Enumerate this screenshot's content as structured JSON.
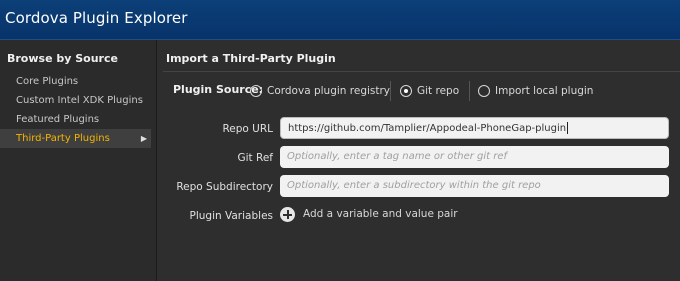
{
  "window": {
    "title": "Cordova Plugin Explorer"
  },
  "sidebar": {
    "heading": "Browse by Source",
    "items": [
      {
        "label": "Core Plugins"
      },
      {
        "label": "Custom Intel XDK Plugins"
      },
      {
        "label": "Featured Plugins"
      },
      {
        "label": "Third-Party Plugins",
        "active": true
      }
    ]
  },
  "main": {
    "heading": "Import a Third-Party Plugin",
    "plugin_source": {
      "label": "Plugin Source:",
      "options": [
        {
          "label": "Cordova plugin registry",
          "checked": false
        },
        {
          "label": "Git repo",
          "checked": true
        },
        {
          "label": "Import local plugin",
          "checked": false
        }
      ]
    },
    "repo_url": {
      "label": "Repo URL",
      "value": "https://github.com/Tamplier/Appodeal-PhoneGap-plugin"
    },
    "git_ref": {
      "label": "Git Ref",
      "placeholder": "Optionally, enter a tag name or other git ref"
    },
    "repo_subdirectory": {
      "label": "Repo Subdirectory",
      "placeholder": "Optionally, enter a subdirectory within the git repo"
    },
    "plugin_variables": {
      "label": "Plugin Variables",
      "add_text": "Add a variable and value pair"
    }
  },
  "colors": {
    "titlebar": "#08336a",
    "active_item_text": "#f4b400",
    "background": "#2e2e2e"
  },
  "icons": {
    "sidebar_active": "chevron-right-icon",
    "add_variable": "plus-circle-icon"
  }
}
